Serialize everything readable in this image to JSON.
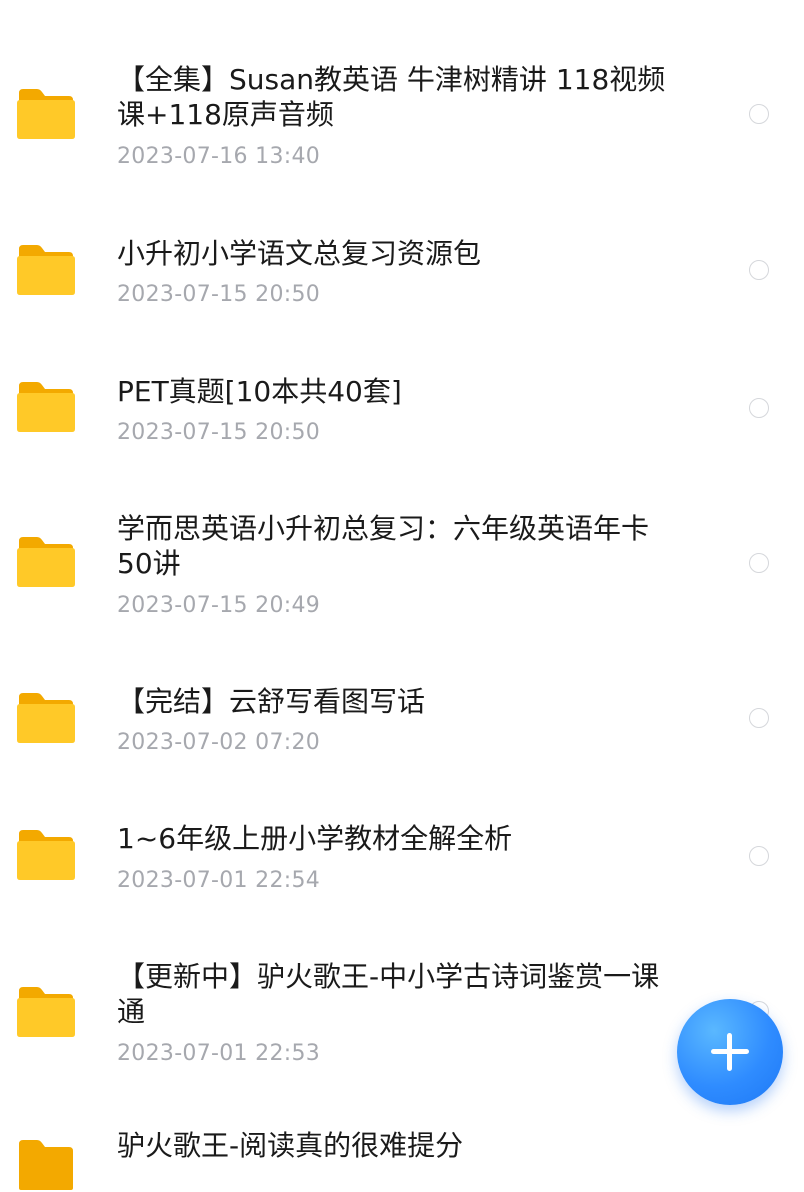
{
  "files": [
    {
      "title": "【全集】Susan教英语 牛津树精讲 118视频课+118原声音频",
      "date": "2023-07-16 13:40"
    },
    {
      "title": "小升初小学语文总复习资源包",
      "date": "2023-07-15 20:50"
    },
    {
      "title": "PET真题[10本共40套]",
      "date": "2023-07-15 20:50"
    },
    {
      "title": "学而思英语小升初总复习：六年级英语年卡50讲",
      "date": "2023-07-15 20:49"
    },
    {
      "title": "【完结】云舒写看图写话",
      "date": "2023-07-02 07:20"
    },
    {
      "title": "1~6年级上册小学教材全解全析",
      "date": "2023-07-01 22:54"
    },
    {
      "title": "【更新中】驴火歌王-中小学古诗词鉴赏一课通",
      "date": "2023-07-01 22:53"
    }
  ],
  "partial_title": "驴火歌王-阅读真的很难提分",
  "colors": {
    "folder": "#ffc21a",
    "accent": "#2f8cff",
    "date": "#a6a8ae"
  },
  "icons": {
    "folder": "folder-icon",
    "fab": "plus-icon"
  }
}
